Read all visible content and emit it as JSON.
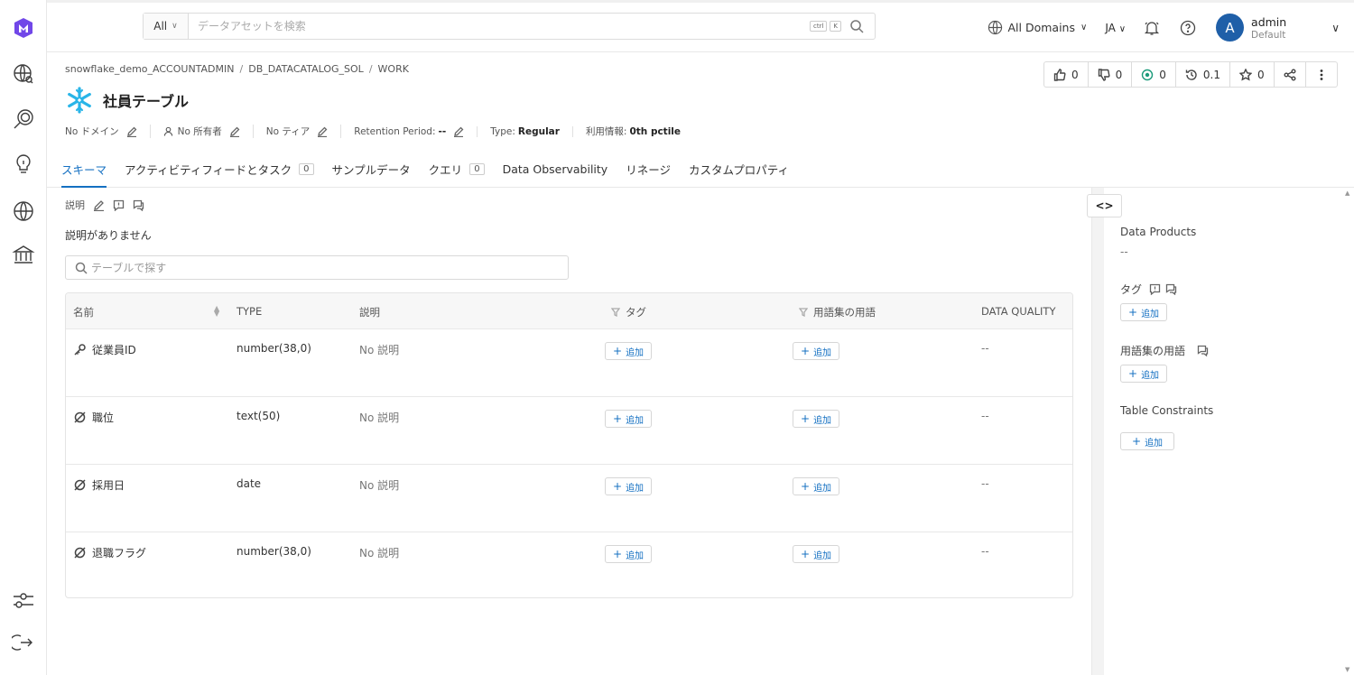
{
  "search": {
    "scope": "All",
    "placeholder": "データアセットを検索",
    "kbd1": "ctrl",
    "kbd2": "K"
  },
  "topbar": {
    "domains": "All Domains",
    "lang": "JA",
    "avatar_letter": "A",
    "user_name": "admin",
    "user_role": "Default"
  },
  "breadcrumb": [
    "snowflake_demo_ACCOUNTADMIN",
    "DB_DATACATALOG_SOL",
    "WORK"
  ],
  "breadcrumb_sep": "/",
  "title": "社員テーブル",
  "votes": {
    "up": "0",
    "down": "0",
    "tasks": "0",
    "version": "0.1",
    "stars": "0"
  },
  "meta": {
    "domain": "No ドメイン",
    "owner": "No 所有者",
    "tier": "No ティア",
    "retention_label": "Retention Period:",
    "retention_value": "--",
    "type_label": "Type:",
    "type_value": "Regular",
    "usage_label": "利用情報:",
    "usage_value": "0th pctile"
  },
  "tabs": [
    {
      "label": "スキーマ"
    },
    {
      "label": "アクティビティフィードとタスク",
      "count": "0"
    },
    {
      "label": "サンプルデータ"
    },
    {
      "label": "クエリ",
      "count": "0"
    },
    {
      "label": "Data Observability"
    },
    {
      "label": "リネージ"
    },
    {
      "label": "カスタムプロパティ"
    }
  ],
  "description": {
    "label": "説明",
    "text": "説明がありません"
  },
  "table_search_placeholder": "テーブルで探す",
  "columns": {
    "name": "名前",
    "type": "TYPE",
    "desc": "説明",
    "tags": "タグ",
    "glossary": "用語集の用語",
    "quality": "DATA QUALITY"
  },
  "rows": [
    {
      "name": "従業員ID",
      "type": "number(38,0)",
      "desc": "No 説明",
      "quality": "--",
      "icon": "key-icon"
    },
    {
      "name": "職位",
      "type": "text(50)",
      "desc": "No 説明",
      "quality": "--",
      "icon": "null-icon"
    },
    {
      "name": "採用日",
      "type": "date",
      "desc": "No 説明",
      "quality": "--",
      "icon": "null-icon"
    },
    {
      "name": "退職フラグ",
      "type": "number(38,0)",
      "desc": "No 説明",
      "quality": "--",
      "icon": "null-icon"
    }
  ],
  "add_label": "追加",
  "add_plus": "+",
  "right_panel": {
    "toggle": "<>",
    "data_products": "Data Products",
    "data_products_value": "--",
    "tags": "タグ",
    "glossary": "用語集の用語",
    "constraints": "Table Constraints"
  },
  "colors": {
    "accent": "#1470c2",
    "avatar": "#1f5fa8",
    "logo": "#29b5e8"
  }
}
